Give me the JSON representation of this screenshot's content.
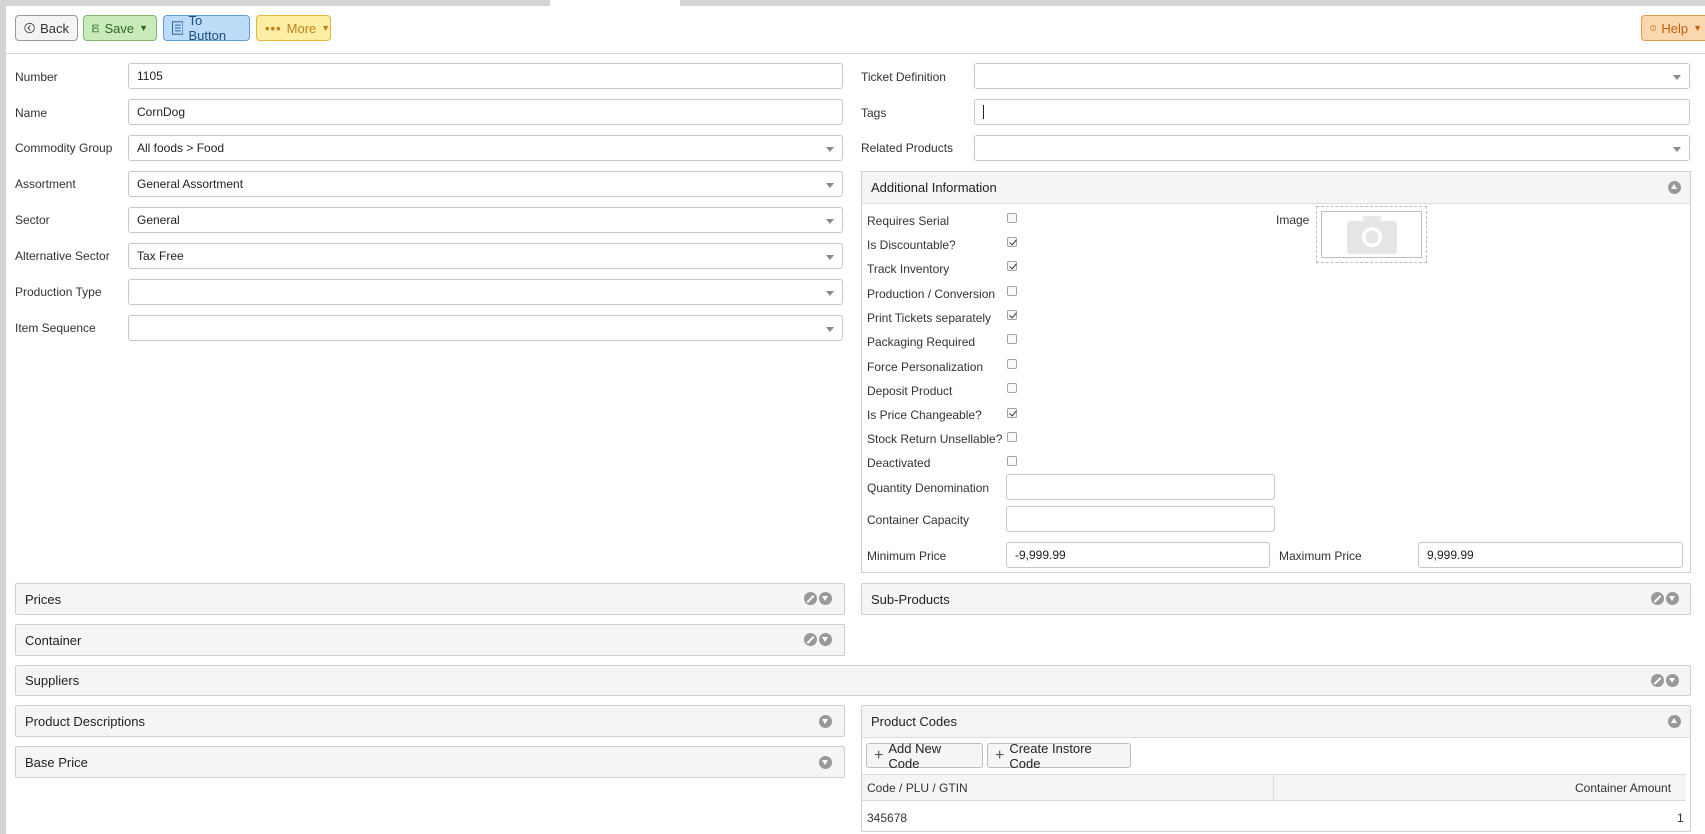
{
  "toolbar": {
    "back_label": "Back",
    "save_label": "Save",
    "to_button_label": "To Button",
    "more_label": "More",
    "help_label": "Help"
  },
  "left_form": {
    "number": {
      "label": "Number",
      "value": "1105"
    },
    "name": {
      "label": "Name",
      "value": "CornDog"
    },
    "commodity_group": {
      "label": "Commodity Group",
      "value": "All foods > Food"
    },
    "assortment": {
      "label": "Assortment",
      "value": "General Assortment"
    },
    "sector": {
      "label": "Sector",
      "value": "General"
    },
    "alternative_sector": {
      "label": "Alternative Sector",
      "value": "Tax Free"
    },
    "production_type": {
      "label": "Production Type",
      "value": ""
    },
    "item_sequence": {
      "label": "Item Sequence",
      "value": ""
    }
  },
  "right_form": {
    "ticket_definition": {
      "label": "Ticket Definition",
      "value": ""
    },
    "tags": {
      "label": "Tags",
      "value": ""
    },
    "related_products": {
      "label": "Related Products",
      "value": ""
    }
  },
  "additional_info": {
    "title": "Additional Information",
    "image_label": "Image",
    "checkboxes": [
      {
        "label": "Requires Serial",
        "checked": false
      },
      {
        "label": "Is Discountable?",
        "checked": true
      },
      {
        "label": "Track Inventory",
        "checked": true
      },
      {
        "label": "Production / Conversion",
        "checked": false
      },
      {
        "label": "Print Tickets separately",
        "checked": true
      },
      {
        "label": "Packaging Required",
        "checked": false
      },
      {
        "label": "Force Personalization",
        "checked": false
      },
      {
        "label": "Deposit Product",
        "checked": false
      },
      {
        "label": "Is Price Changeable?",
        "checked": true
      },
      {
        "label": "Stock Return Unsellable?",
        "checked": false
      },
      {
        "label": "Deactivated",
        "checked": false
      }
    ],
    "quantity_denomination": {
      "label": "Quantity Denomination",
      "value": ""
    },
    "container_capacity": {
      "label": "Container Capacity",
      "value": ""
    },
    "minimum_price": {
      "label": "Minimum Price",
      "value": "-9,999.99"
    },
    "maximum_price": {
      "label": "Maximum Price",
      "value": "9,999.99"
    }
  },
  "panels": {
    "prices": "Prices",
    "container": "Container",
    "sub_products": "Sub-Products",
    "suppliers": "Suppliers",
    "product_descriptions": "Product Descriptions",
    "base_price": "Base Price",
    "product_codes": "Product Codes"
  },
  "product_codes": {
    "add_new_code": "Add New Code",
    "create_instore_code": "Create Instore Code",
    "columns": [
      "Code / PLU / GTIN",
      "Container Amount"
    ],
    "rows": [
      [
        "345678",
        "1"
      ]
    ]
  }
}
